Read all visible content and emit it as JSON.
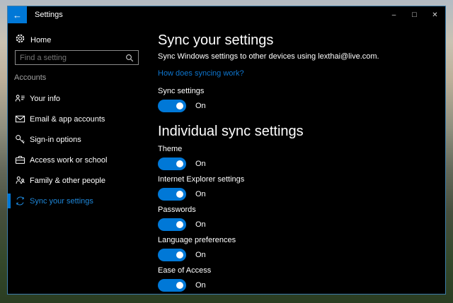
{
  "window": {
    "title": "Settings",
    "back_glyph": "←",
    "controls": {
      "minimize": "–",
      "maximize": "□",
      "close": "✕"
    }
  },
  "sidebar": {
    "home_label": "Home",
    "search_placeholder": "Find a setting",
    "section_label": "Accounts",
    "items": [
      {
        "label": "Your info",
        "icon": "user-info-icon",
        "selected": false
      },
      {
        "label": "Email & app accounts",
        "icon": "email-icon",
        "selected": false
      },
      {
        "label": "Sign-in options",
        "icon": "key-icon",
        "selected": false
      },
      {
        "label": "Access work or school",
        "icon": "briefcase-icon",
        "selected": false
      },
      {
        "label": "Family & other people",
        "icon": "people-icon",
        "selected": false
      },
      {
        "label": "Sync your settings",
        "icon": "sync-icon",
        "selected": true
      }
    ]
  },
  "main": {
    "title": "Sync your settings",
    "description": "Sync Windows settings to other devices using lexthai@live.com.",
    "link": "How does syncing work?",
    "master_toggle": {
      "label": "Sync settings",
      "state": "On"
    },
    "section_title": "Individual sync settings",
    "toggles": [
      {
        "label": "Theme",
        "state": "On"
      },
      {
        "label": "Internet Explorer settings",
        "state": "On"
      },
      {
        "label": "Passwords",
        "state": "On"
      },
      {
        "label": "Language preferences",
        "state": "On"
      },
      {
        "label": "Ease of Access",
        "state": "On"
      }
    ]
  },
  "colors": {
    "accent": "#0078d7",
    "link": "#0e76cf",
    "selected_text": "#1e87d9",
    "window_border": "#3d7dab"
  }
}
